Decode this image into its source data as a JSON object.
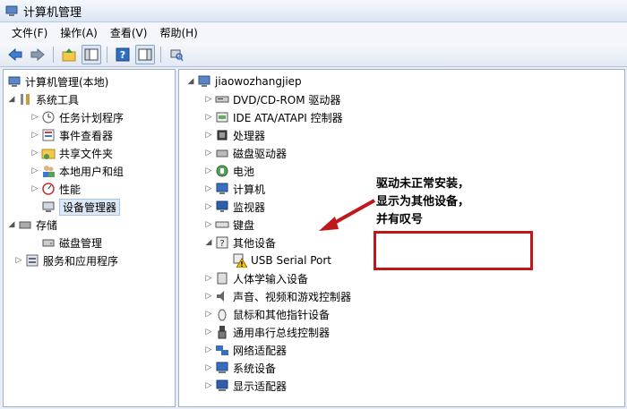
{
  "window": {
    "title": "计算机管理"
  },
  "menu": [
    "文件(F)",
    "操作(A)",
    "查看(V)",
    "帮助(H)"
  ],
  "left_tree": {
    "root": "计算机管理(本地)",
    "system_tools": "系统工具",
    "task_scheduler": "任务计划程序",
    "event_viewer": "事件查看器",
    "shared_folders": "共享文件夹",
    "local_users": "本地用户和组",
    "performance": "性能",
    "device_manager": "设备管理器",
    "storage": "存储",
    "disk_management": "磁盘管理",
    "services_apps": "服务和应用程序"
  },
  "device_tree": {
    "computer_name": "jiaowozhangjiep",
    "categories": [
      "DVD/CD-ROM 驱动器",
      "IDE ATA/ATAPI 控制器",
      "处理器",
      "磁盘驱动器",
      "电池",
      "计算机",
      "监视器",
      "键盘",
      "其他设备",
      "人体学输入设备",
      "声音、视频和游戏控制器",
      "鼠标和其他指针设备",
      "通用串行总线控制器",
      "网络适配器",
      "系统设备",
      "显示适配器"
    ],
    "other_device_child": "USB Serial Port"
  },
  "annotation": {
    "line1": "驱动未正常安装，",
    "line2": "显示为其他设备，",
    "line3": "并有叹号"
  },
  "colors": {
    "annotation_red": "#c0171d",
    "selection": "#dde8f6"
  }
}
